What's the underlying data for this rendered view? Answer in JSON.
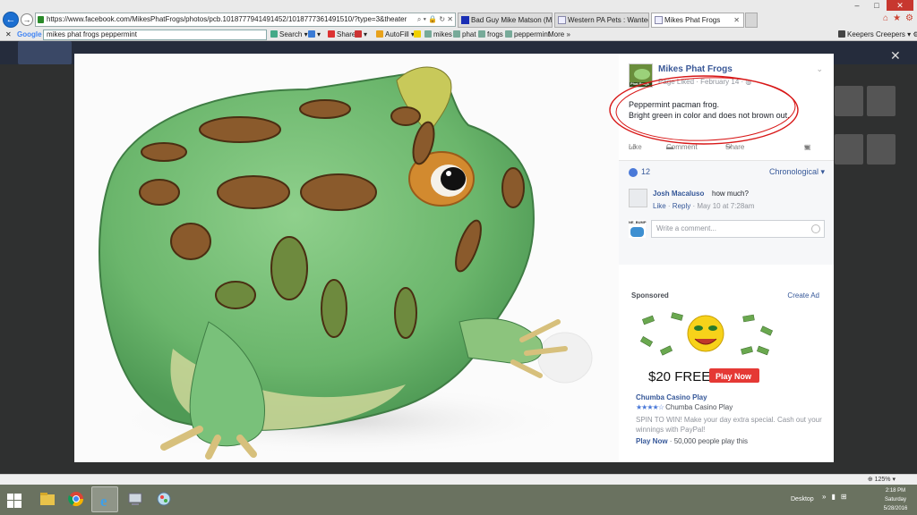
{
  "browser": {
    "address_url": "https://www.facebook.com/MikesPhatFrogs/photos/pcb.1018777941491452/1018777361491510/?type=3&theater",
    "tabs": [
      {
        "label": "Bad Guy Mike Matson (Mikes ...",
        "active": false
      },
      {
        "label": "Western PA Pets : Wanted, Fre...",
        "active": false
      },
      {
        "label": "Mikes Phat Frogs",
        "active": true
      }
    ]
  },
  "toolbar": {
    "google_label": "Google",
    "search_value": "mikes phat frogs peppermint",
    "search_btn": "Search",
    "share_btn": "Share",
    "autofill_btn": "AutoFill",
    "words": [
      "mikes",
      "phat",
      "frogs",
      "peppermint"
    ],
    "more": "More »",
    "keepers": "Keepers Creepers"
  },
  "post": {
    "page_name": "Mikes Phat Frogs",
    "thumb_text": "Phat Frogs",
    "meta": "Page Liked · February 14 · ",
    "caption_line1": "Peppermint pacman frog.",
    "caption_line2": "Bright green in color and does not brown out.",
    "actions": {
      "like": "Like",
      "comment": "Comment",
      "share": "Share"
    }
  },
  "reactions": {
    "count": "12",
    "sort": "Chronological ▾"
  },
  "comment": {
    "author": "Josh Macaluso",
    "text": "how much?",
    "like": "Like",
    "reply": "Reply",
    "time": "May 10 at 7:28am"
  },
  "write_comment": {
    "placeholder": "Write a comment...",
    "avatar_text": "NE_BUMP"
  },
  "sponsored": {
    "label": "Sponsored",
    "create_ad": "Create Ad",
    "ad_free_text": "$20 FREE",
    "ad_play_text": "Play Now",
    "title": "Chumba Casino Play",
    "source": "Chumba Casino Play",
    "description": "SPIN TO WIN! Make your day extra special. Cash out your winnings with PayPal!",
    "cta": "Play Now",
    "social": " · 50,000 people play this"
  },
  "statusbar": {
    "zoom": "125%"
  },
  "taskbar": {
    "desktop": "Desktop",
    "time": "2:18 PM",
    "day": "Saturday",
    "date": "5/28/2016"
  },
  "colors": {
    "fb_blue": "#3b5998",
    "link_blue": "#365899",
    "annotation_red": "#d81818",
    "frog_green": "#75c07a"
  }
}
